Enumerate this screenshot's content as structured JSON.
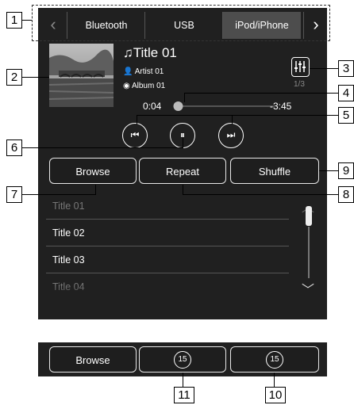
{
  "tabs": [
    "Bluetooth",
    "USB",
    "iPod/iPhone"
  ],
  "track": {
    "title": "Title 01",
    "artist": "Artist 01",
    "album": "Album 01",
    "count": "1/3"
  },
  "time": {
    "elapsed": "0:04",
    "remaining": "-3:45",
    "progress": 0.02
  },
  "buttons": {
    "browse": "Browse",
    "repeat": "Repeat",
    "shuffle": "Shuffle"
  },
  "playlist": [
    "Title 01",
    "Title 02",
    "Title 03",
    "Title 04"
  ],
  "bottom_bar": {
    "browse": "Browse",
    "rewind_seconds": "15",
    "forward_seconds": "15"
  },
  "callouts": [
    "1",
    "2",
    "3",
    "4",
    "5",
    "6",
    "7",
    "8",
    "9",
    "10",
    "11"
  ],
  "colors": {
    "screen": "#202020",
    "active_tab": "#4d4d4d",
    "progress_knob": "#bbbbbb"
  }
}
